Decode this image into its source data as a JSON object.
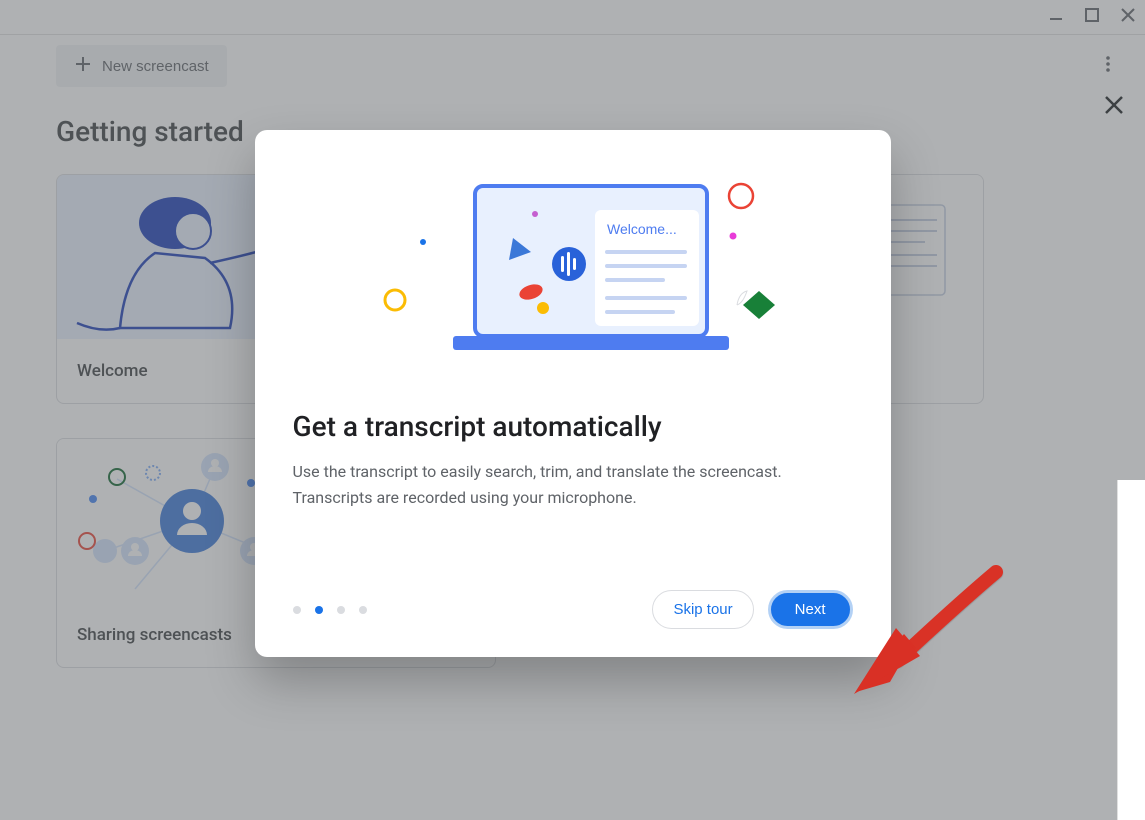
{
  "toolbar": {
    "new_button_label": "New screencast"
  },
  "page": {
    "title": "Getting started"
  },
  "cards": [
    {
      "label": "Welcome"
    },
    {
      "label": "Sharing screencasts"
    }
  ],
  "modal": {
    "illustration_text": "Welcome...",
    "title": "Get a transcript automatically",
    "description": "Use the transcript to easily search, trim, and translate the screencast. Transcripts are recorded using your microphone.",
    "skip_label": "Skip tour",
    "next_label": "Next",
    "step_active": 1,
    "step_total": 4
  },
  "colors": {
    "primary": "#1a73e8",
    "accent_red": "#ea4335",
    "accent_yellow": "#fbbc04",
    "accent_green": "#188038"
  }
}
